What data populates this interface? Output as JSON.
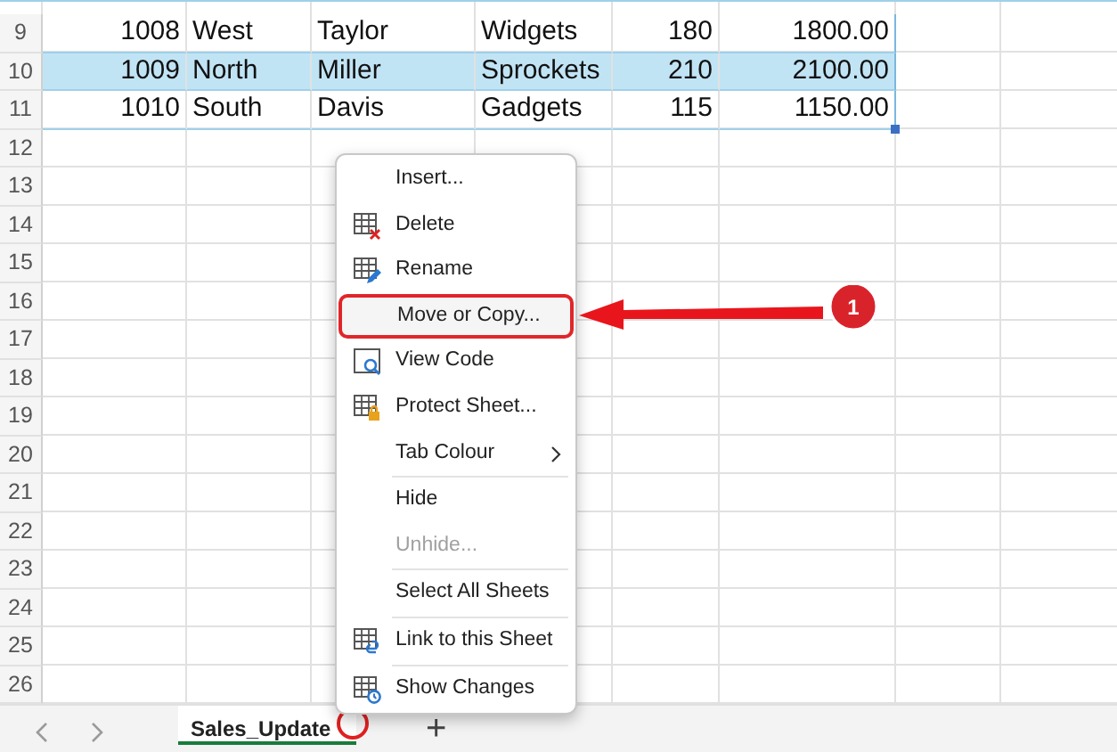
{
  "sheet": {
    "rows": [
      {
        "number": "9",
        "banded": false,
        "cells": [
          "1008",
          "West",
          "Taylor",
          "Widgets",
          "180",
          "1800.00"
        ]
      },
      {
        "number": "10",
        "banded": true,
        "cells": [
          "1009",
          "North",
          "Miller",
          "Sprockets",
          "210",
          "2100.00"
        ]
      },
      {
        "number": "11",
        "banded": false,
        "cells": [
          "1010",
          "South",
          "Davis",
          "Gadgets",
          "115",
          "1150.00"
        ]
      },
      {
        "number": "12"
      },
      {
        "number": "13"
      },
      {
        "number": "14"
      },
      {
        "number": "15"
      },
      {
        "number": "16"
      },
      {
        "number": "17"
      },
      {
        "number": "18"
      },
      {
        "number": "19"
      },
      {
        "number": "20"
      },
      {
        "number": "21"
      },
      {
        "number": "22"
      },
      {
        "number": "23"
      },
      {
        "number": "24"
      },
      {
        "number": "25"
      },
      {
        "number": "26"
      }
    ]
  },
  "context_menu": {
    "items": [
      {
        "label": "Insert...",
        "kind": "plain",
        "disabled": false,
        "highlighted": false
      },
      {
        "label": "Delete",
        "kind": "delete",
        "disabled": false,
        "highlighted": false
      },
      {
        "label": "Rename",
        "kind": "rename",
        "disabled": false,
        "highlighted": false
      },
      {
        "label": "Move or Copy...",
        "kind": "plain",
        "disabled": false,
        "highlighted": true
      },
      {
        "label": "View Code",
        "kind": "code",
        "disabled": false,
        "highlighted": false
      },
      {
        "label": "Protect Sheet...",
        "kind": "lock",
        "disabled": false,
        "highlighted": false
      },
      {
        "label": "Tab Colour",
        "kind": "plain",
        "disabled": false,
        "highlighted": false,
        "submenu": true
      },
      {
        "label": "Hide",
        "kind": "plain",
        "disabled": false,
        "highlighted": false,
        "separator_before": true
      },
      {
        "label": "Unhide...",
        "kind": "plain",
        "disabled": true,
        "highlighted": false
      },
      {
        "label": "Select All Sheets",
        "kind": "plain",
        "disabled": false,
        "highlighted": false,
        "separator_before": true
      },
      {
        "label": "Link to this Sheet",
        "kind": "link",
        "disabled": false,
        "highlighted": false,
        "separator_before": true
      },
      {
        "label": "Show Changes",
        "kind": "history",
        "disabled": false,
        "highlighted": false,
        "separator_before": true
      }
    ]
  },
  "callout": {
    "number": "1"
  },
  "sheet_tabs": [
    {
      "label": "Sales_Update",
      "selected": true
    }
  ],
  "new_sheet_button": "+"
}
